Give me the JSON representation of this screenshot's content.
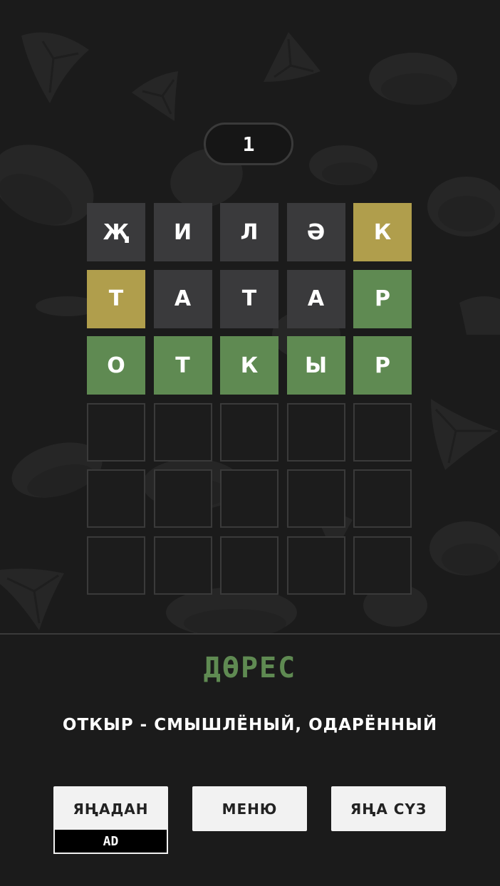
{
  "round": "1",
  "board": [
    [
      {
        "l": "Җ",
        "s": "absent"
      },
      {
        "l": "И",
        "s": "absent"
      },
      {
        "l": "Л",
        "s": "absent"
      },
      {
        "l": "Ә",
        "s": "absent"
      },
      {
        "l": "К",
        "s": "present"
      }
    ],
    [
      {
        "l": "Т",
        "s": "present"
      },
      {
        "l": "А",
        "s": "absent"
      },
      {
        "l": "Т",
        "s": "absent"
      },
      {
        "l": "А",
        "s": "absent"
      },
      {
        "l": "Р",
        "s": "correct"
      }
    ],
    [
      {
        "l": "О",
        "s": "correct"
      },
      {
        "l": "Т",
        "s": "correct"
      },
      {
        "l": "К",
        "s": "correct"
      },
      {
        "l": "Ы",
        "s": "correct"
      },
      {
        "l": "Р",
        "s": "correct"
      }
    ],
    [
      {
        "l": "",
        "s": "empty"
      },
      {
        "l": "",
        "s": "empty"
      },
      {
        "l": "",
        "s": "empty"
      },
      {
        "l": "",
        "s": "empty"
      },
      {
        "l": "",
        "s": "empty"
      }
    ],
    [
      {
        "l": "",
        "s": "empty"
      },
      {
        "l": "",
        "s": "empty"
      },
      {
        "l": "",
        "s": "empty"
      },
      {
        "l": "",
        "s": "empty"
      },
      {
        "l": "",
        "s": "empty"
      }
    ],
    [
      {
        "l": "",
        "s": "empty"
      },
      {
        "l": "",
        "s": "empty"
      },
      {
        "l": "",
        "s": "empty"
      },
      {
        "l": "",
        "s": "empty"
      },
      {
        "l": "",
        "s": "empty"
      }
    ]
  ],
  "colors": {
    "absent": "#3a3a3c",
    "present": "#b09e4c",
    "correct": "#5f8a52"
  },
  "result": {
    "title": "ДӨРЕС",
    "definition": "ОТКЫР - СМЫШЛЁНЫЙ, ОДАРЁННЫЙ"
  },
  "buttons": {
    "retry": "ЯҢАДАН",
    "retry_badge": "AD",
    "menu": "МЕНЮ",
    "new_word": "ЯҢА СҮЗ"
  }
}
